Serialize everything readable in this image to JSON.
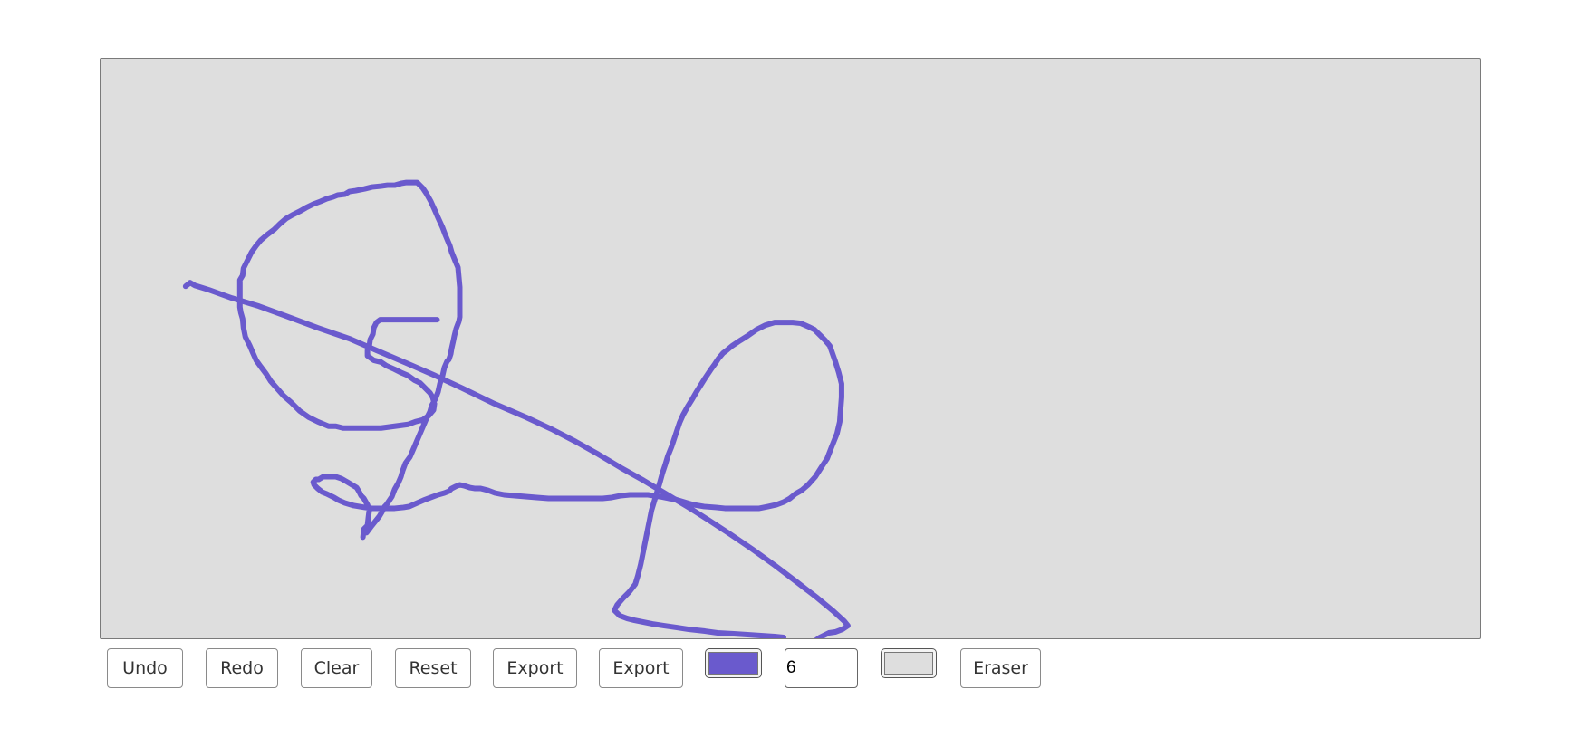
{
  "canvas": {
    "background": "#dedede",
    "stroke_color": "#6a5acd"
  },
  "toolbar": {
    "undo_label": "Undo",
    "redo_label": "Redo",
    "clear_label": "Clear",
    "reset_label": "Reset",
    "export_label_1": "Export",
    "export_label_2": "Export",
    "stroke_color": "#6a5acd",
    "brush_size": "6",
    "background_color": "#dedede",
    "eraser_label": "Eraser"
  }
}
